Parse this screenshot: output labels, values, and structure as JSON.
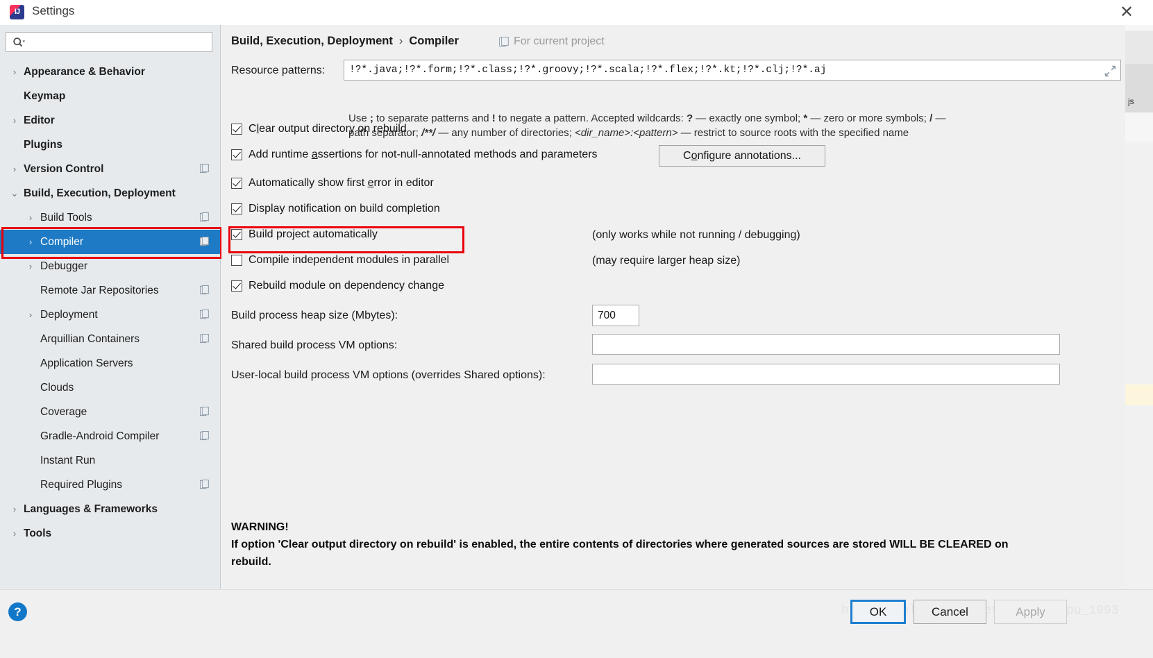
{
  "window": {
    "title": "Settings",
    "app_icon": "intellij-idea-icon",
    "close_label": "✕"
  },
  "sidebar": {
    "search": {
      "placeholder": "",
      "value": "",
      "icon": "search-icon"
    },
    "items": [
      {
        "label": "Appearance & Behavior",
        "level": 0,
        "arrow": "›",
        "bold": true,
        "selected": false,
        "project_icon": false
      },
      {
        "label": "Keymap",
        "level": 0,
        "arrow": "",
        "bold": true,
        "selected": false,
        "project_icon": false
      },
      {
        "label": "Editor",
        "level": 0,
        "arrow": "›",
        "bold": true,
        "selected": false,
        "project_icon": false
      },
      {
        "label": "Plugins",
        "level": 0,
        "arrow": "",
        "bold": true,
        "selected": false,
        "project_icon": false
      },
      {
        "label": "Version Control",
        "level": 0,
        "arrow": "›",
        "bold": true,
        "selected": false,
        "project_icon": true
      },
      {
        "label": "Build, Execution, Deployment",
        "level": 0,
        "arrow": "⌄",
        "bold": true,
        "selected": false,
        "project_icon": false
      },
      {
        "label": "Build Tools",
        "level": 1,
        "arrow": "›",
        "bold": false,
        "selected": false,
        "project_icon": true
      },
      {
        "label": "Compiler",
        "level": 1,
        "arrow": "›",
        "bold": false,
        "selected": true,
        "project_icon": true
      },
      {
        "label": "Debugger",
        "level": 1,
        "arrow": "›",
        "bold": false,
        "selected": false,
        "project_icon": false
      },
      {
        "label": "Remote Jar Repositories",
        "level": 1,
        "arrow": "",
        "bold": false,
        "selected": false,
        "project_icon": true
      },
      {
        "label": "Deployment",
        "level": 1,
        "arrow": "›",
        "bold": false,
        "selected": false,
        "project_icon": true
      },
      {
        "label": "Arquillian Containers",
        "level": 1,
        "arrow": "",
        "bold": false,
        "selected": false,
        "project_icon": true
      },
      {
        "label": "Application Servers",
        "level": 1,
        "arrow": "",
        "bold": false,
        "selected": false,
        "project_icon": false
      },
      {
        "label": "Clouds",
        "level": 1,
        "arrow": "",
        "bold": false,
        "selected": false,
        "project_icon": false
      },
      {
        "label": "Coverage",
        "level": 1,
        "arrow": "",
        "bold": false,
        "selected": false,
        "project_icon": true
      },
      {
        "label": "Gradle-Android Compiler",
        "level": 1,
        "arrow": "",
        "bold": false,
        "selected": false,
        "project_icon": true
      },
      {
        "label": "Instant Run",
        "level": 1,
        "arrow": "",
        "bold": false,
        "selected": false,
        "project_icon": false
      },
      {
        "label": "Required Plugins",
        "level": 1,
        "arrow": "",
        "bold": false,
        "selected": false,
        "project_icon": true
      },
      {
        "label": "Languages & Frameworks",
        "level": 0,
        "arrow": "›",
        "bold": true,
        "selected": false,
        "project_icon": false
      },
      {
        "label": "Tools",
        "level": 0,
        "arrow": "›",
        "bold": true,
        "selected": false,
        "project_icon": false
      }
    ]
  },
  "main": {
    "breadcrumb_root": "Build, Execution, Deployment",
    "breadcrumb_sep": "›",
    "breadcrumb_leaf": "Compiler",
    "scope_label": "For current project",
    "scope_icon": "project-scope-icon",
    "resource_patterns_label": "Resource patterns:",
    "resource_patterns_value": "!?*.java;!?*.form;!?*.class;!?*.groovy;!?*.scala;!?*.flex;!?*.kt;!?*.clj;!?*.aj",
    "expand_icon": "expand-diagonal-icon",
    "hint_line1_a": "Use ",
    "hint_semicolon": ";",
    "hint_line1_b": " to separate patterns and ",
    "hint_bang": "!",
    "hint_line1_c": " to negate a pattern. Accepted wildcards: ",
    "hint_q": "?",
    "hint_line1_d": " — exactly one symbol; ",
    "hint_star": "*",
    "hint_line1_e": " — zero or more symbols; ",
    "hint_slash": "/",
    "hint_line1_f": " —",
    "hint_line2_a": "path separator; ",
    "hint_globstar": "/**/",
    "hint_line2_b": " — any number of directories;  ",
    "hint_dirpattern": "<dir_name>:<pattern>",
    "hint_line2_c": " — restrict to source roots with the specified name",
    "checkboxes": [
      {
        "label_pre": "C",
        "label_mnemonic": "l",
        "label_post": "ear output directory on rebuild",
        "full": "Clear output directory on rebuild",
        "checked": true,
        "note": ""
      },
      {
        "label_pre": "Add runtime ",
        "label_mnemonic": "a",
        "label_post": "ssertions for not-null-annotated methods and parameters",
        "full": "Add runtime assertions for not-null-annotated methods and parameters",
        "checked": true,
        "note": ""
      },
      {
        "label_pre": "Automatically show first ",
        "label_mnemonic": "e",
        "label_post": "rror in editor",
        "full": "Automatically show first error in editor",
        "checked": true,
        "note": ""
      },
      {
        "label_pre": "Display notification on build completion",
        "label_mnemonic": "",
        "label_post": "",
        "full": "Display notification on build completion",
        "checked": true,
        "note": ""
      },
      {
        "label_pre": "Build project automatically",
        "label_mnemonic": "",
        "label_post": "",
        "full": "Build project automatically",
        "checked": true,
        "note": "(only works while not running / debugging)"
      },
      {
        "label_pre": "Compile independent modules in parallel",
        "label_mnemonic": "",
        "label_post": "",
        "full": "Compile independent modules in parallel",
        "checked": false,
        "note": "(may require larger heap size)"
      },
      {
        "label_pre": "Rebuild module on dependency change",
        "label_mnemonic": "",
        "label_post": "",
        "full": "Rebuild module on dependency change",
        "checked": true,
        "note": ""
      }
    ],
    "configure_annotations_pre": "C",
    "configure_annotations_mnemonic": "o",
    "configure_annotations_post": "nfigure annotations...",
    "configure_annotations_full": "Configure annotations...",
    "heap_label": "Build process heap size (Mbytes):",
    "heap_value": "700",
    "shared_vm_label": "Shared build process VM options:",
    "shared_vm_value": "",
    "user_vm_label": "User-local build process VM options (overrides Shared options):",
    "user_vm_value": "",
    "warning_title": "WARNING!",
    "warning_body": "If option 'Clear output directory on rebuild' is enabled, the entire contents of directories where generated sources are stored WILL BE CLEARED on rebuild."
  },
  "footer": {
    "help_label": "?",
    "ok_label": "OK",
    "cancel_label": "Cancel",
    "apply_label": "Apply",
    "watermark": "https://blog.csdn.net/baijinswpu_1993"
  },
  "background_window": {
    "tab_label": "js"
  },
  "colors": {
    "selection": "#1e7ac4",
    "annotation": "#e8000b",
    "sidebar_bg": "#e6eaed",
    "panel_bg": "#f0f0f0",
    "focus_border": "#1f7fd0"
  }
}
